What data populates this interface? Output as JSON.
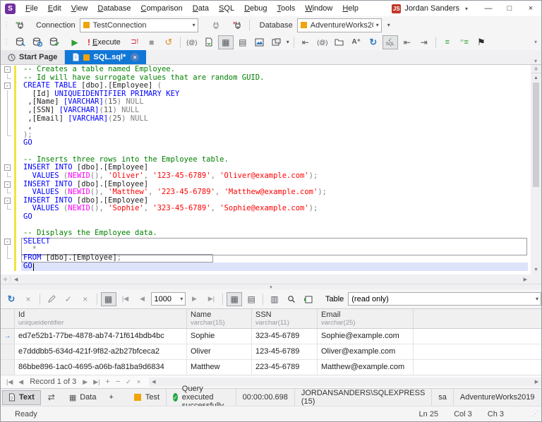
{
  "title_bar": {
    "app_initial": "S",
    "menus": [
      "File",
      "Edit",
      "View",
      "Database",
      "Comparison",
      "Data",
      "SQL",
      "Debug",
      "Tools",
      "Window",
      "Help"
    ],
    "account_initials": "JS",
    "account_name": "Jordan Sanders"
  },
  "toolbar_connection": {
    "connection_label": "Connection",
    "connection_value": "TestConnection",
    "database_label": "Database",
    "database_value": "AdventureWorks20..."
  },
  "toolbar_execute": {
    "execute_label": "Execute"
  },
  "tab_strip": {
    "start_page": "Start Page",
    "sql_tab": "SQL.sql*"
  },
  "editor": {
    "lines": [
      {
        "fold": "box",
        "seg": [
          [
            "c",
            "-- Creates a table named Employee."
          ]
        ]
      },
      {
        "fold": "end",
        "seg": [
          [
            "c",
            "-- Id will have surrogate values that are random GUID."
          ]
        ]
      },
      {
        "fold": "box",
        "seg": [
          [
            "k",
            "CREATE TABLE"
          ],
          [
            "p",
            " [dbo].[Employee] "
          ],
          [
            "g",
            "("
          ]
        ]
      },
      {
        "fold": "v",
        "seg": [
          [
            "p",
            "  [Id] "
          ],
          [
            "k",
            "UNIQUEIDENTIFIER PRIMARY KEY"
          ]
        ]
      },
      {
        "fold": "v",
        "seg": [
          [
            "p",
            " ,[Name] "
          ],
          [
            "k",
            "[VARCHAR]"
          ],
          [
            "g",
            "("
          ],
          [
            "n",
            "15"
          ],
          [
            "g",
            ") NULL"
          ]
        ]
      },
      {
        "fold": "v",
        "seg": [
          [
            "p",
            " ,[SSN] "
          ],
          [
            "k",
            "[VARCHAR]"
          ],
          [
            "g",
            "("
          ],
          [
            "n",
            "11"
          ],
          [
            "g",
            ") NULL"
          ]
        ]
      },
      {
        "fold": "v",
        "seg": [
          [
            "p",
            " ,[Email] "
          ],
          [
            "k",
            "[VARCHAR]"
          ],
          [
            "g",
            "("
          ],
          [
            "n",
            "25"
          ],
          [
            "g",
            ") NULL"
          ]
        ]
      },
      {
        "fold": "v",
        "seg": [
          [
            "p",
            " ,"
          ]
        ]
      },
      {
        "fold": "end",
        "seg": [
          [
            "g",
            ");"
          ]
        ]
      },
      {
        "fold": "",
        "seg": [
          [
            "k",
            "GO"
          ]
        ]
      },
      {
        "fold": "",
        "seg": []
      },
      {
        "fold": "",
        "seg": [
          [
            "c",
            "-- Inserts three rows into the Employee table."
          ]
        ]
      },
      {
        "fold": "box",
        "seg": [
          [
            "k",
            "INSERT INTO"
          ],
          [
            "p",
            " [dbo].[Employee]"
          ]
        ]
      },
      {
        "fold": "end",
        "seg": [
          [
            "p",
            "  "
          ],
          [
            "k",
            "VALUES"
          ],
          [
            "g",
            " ("
          ],
          [
            "f",
            "NEWID"
          ],
          [
            "g",
            "(), "
          ],
          [
            "s",
            "'Oliver'"
          ],
          [
            "g",
            ", "
          ],
          [
            "s",
            "'123-45-6789'"
          ],
          [
            "g",
            ", "
          ],
          [
            "s",
            "'Oliver@example.com'"
          ],
          [
            "g",
            ");"
          ]
        ]
      },
      {
        "fold": "box",
        "seg": [
          [
            "k",
            "INSERT INTO"
          ],
          [
            "p",
            " [dbo].[Employee]"
          ]
        ]
      },
      {
        "fold": "end",
        "seg": [
          [
            "p",
            "  "
          ],
          [
            "k",
            "VALUES"
          ],
          [
            "g",
            " ("
          ],
          [
            "f",
            "NEWID"
          ],
          [
            "g",
            "(), "
          ],
          [
            "s",
            "'Matthew'"
          ],
          [
            "g",
            ", "
          ],
          [
            "s",
            "'223-45-6789'"
          ],
          [
            "g",
            ", "
          ],
          [
            "s",
            "'Matthew@example.com'"
          ],
          [
            "g",
            ");"
          ]
        ]
      },
      {
        "fold": "box",
        "seg": [
          [
            "k",
            "INSERT INTO"
          ],
          [
            "p",
            " [dbo].[Employee]"
          ]
        ]
      },
      {
        "fold": "end",
        "seg": [
          [
            "p",
            "  "
          ],
          [
            "k",
            "VALUES"
          ],
          [
            "g",
            " ("
          ],
          [
            "f",
            "NEWID"
          ],
          [
            "g",
            "(), "
          ],
          [
            "s",
            "'Sophie'"
          ],
          [
            "g",
            ", "
          ],
          [
            "s",
            "'323-45-6789'"
          ],
          [
            "g",
            ", "
          ],
          [
            "s",
            "'Sophie@example.com'"
          ],
          [
            "g",
            ");"
          ]
        ]
      },
      {
        "fold": "",
        "seg": [
          [
            "k",
            "GO"
          ]
        ]
      },
      {
        "fold": "",
        "seg": []
      },
      {
        "fold": "",
        "seg": [
          [
            "c",
            "-- Displays the Employee data."
          ]
        ]
      },
      {
        "fold": "box",
        "seg": [
          [
            "k",
            "SELECT"
          ]
        ]
      },
      {
        "fold": "v",
        "seg": [
          [
            "g",
            "  *"
          ]
        ]
      },
      {
        "fold": "end",
        "seg": [
          [
            "k",
            "FROM"
          ],
          [
            "p",
            " [dbo].[Employee]"
          ],
          [
            "g",
            ";"
          ]
        ]
      },
      {
        "fold": "",
        "seg": [
          [
            "k",
            "GO"
          ]
        ],
        "caret": true
      }
    ]
  },
  "results_toolbar": {
    "page_size": "1000",
    "table_label": "Table",
    "table_mode": "(read only)"
  },
  "grid": {
    "columns": [
      {
        "name": "Id",
        "type": "uniqueidentifier"
      },
      {
        "name": "Name",
        "type": "varchar(15)"
      },
      {
        "name": "SSN",
        "type": "varchar(11)"
      },
      {
        "name": "Email",
        "type": "varchar(25)"
      }
    ],
    "rows": [
      [
        "ed7e52b1-77be-4878-ab74-71f614bdb4bc",
        "Sophie",
        "323-45-6789",
        "Sophie@example.com"
      ],
      [
        "e7dddbb5-634d-421f-9f82-a2b27bfceca2",
        "Oliver",
        "123-45-6789",
        "Oliver@example.com"
      ],
      [
        "86bbe896-1ac0-4695-a06b-fa81ba9d6834",
        "Matthew",
        "223-45-6789",
        "Matthew@example.com"
      ]
    ],
    "selected_row": 0
  },
  "record_navigator": {
    "label": "Record 1 of 3"
  },
  "bottom_bar": {
    "text_tab": "Text",
    "data_tab": "Data",
    "plus_tab": "+",
    "connection_tag": "Test",
    "status_message": "Query executed successfully.",
    "duration": "00:00:00.698",
    "server": "JORDANSANDERS\\SQLEXPRESS (15)",
    "user": "sa",
    "database": "AdventureWorks2019"
  },
  "status_bar": {
    "state": "Ready",
    "line": "Ln 25",
    "column": "Col 3",
    "character": "Ch 3"
  },
  "icons": {
    "play": "▶",
    "stop": "■",
    "history": "↺",
    "refresh": "↻",
    "swap": "⇄",
    "outdent": "⇤",
    "indent": "⇥",
    "grid_view": "▦",
    "card_view": "▤",
    "column_view": "▥",
    "bookmark": "⚑",
    "check": "✓",
    "close": "×",
    "caret_down": "▾",
    "prev": "◀",
    "next": "▶",
    "first": "|◀",
    "last": "▶|",
    "plus": "+",
    "minus": "−",
    "at": "(@)",
    "uppercase": "A⁺",
    "bang": "!",
    "exec_script": "⊐!",
    "minimize": "—",
    "maximize": "□",
    "format_l": "≡",
    "format_r": "⁼≡",
    "dots": "⋮",
    "chev_up_down": "≑"
  },
  "colors": {
    "accent_blue": "#1177d7",
    "keyword": "#0000ff",
    "comment": "#008000",
    "string": "#ff0000",
    "function": "#ff00ff",
    "tag_orange": "#f0a30a",
    "success_green": "#27a744",
    "change_bar_yellow": "#f2e33d"
  }
}
